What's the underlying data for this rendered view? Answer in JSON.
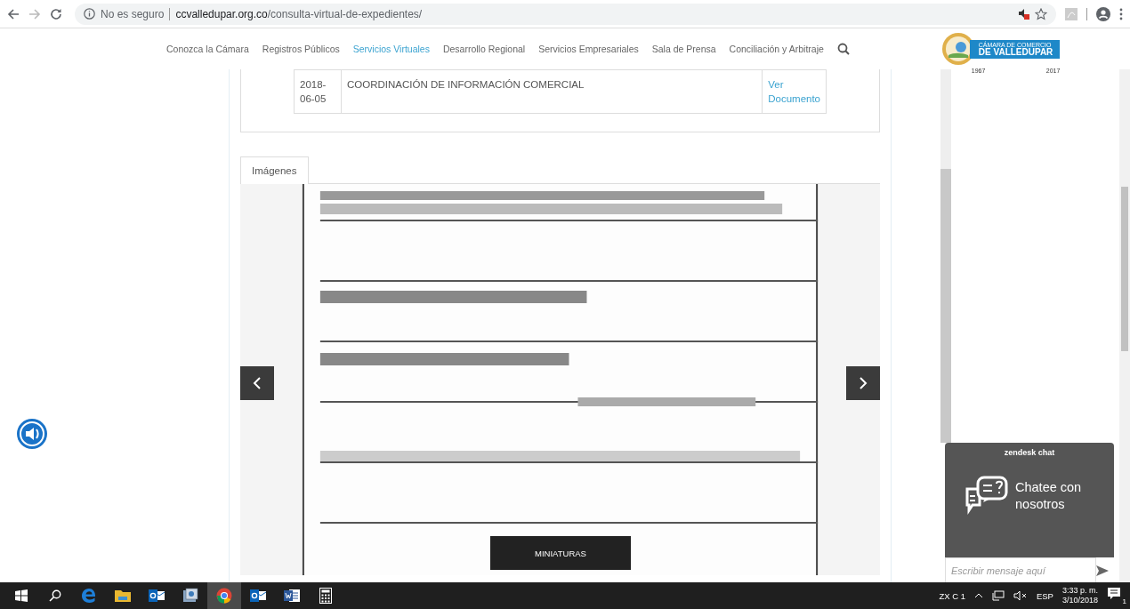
{
  "omnibox": {
    "security": "No es seguro",
    "domain": "ccvalledupar.org.co",
    "path": "/consulta-virtual-de-expedientes/"
  },
  "nav": {
    "items": [
      {
        "label": "Conozca la Cámara",
        "selected": false
      },
      {
        "label": "Registros Públicos",
        "selected": false
      },
      {
        "label": "Servicios Virtuales",
        "selected": true
      },
      {
        "label": "Desarrollo Regional",
        "selected": false
      },
      {
        "label": "Servicios Empresariales",
        "selected": false
      },
      {
        "label": "Sala de Prensa",
        "selected": false
      },
      {
        "label": "Conciliación y Arbitraje",
        "selected": false
      }
    ]
  },
  "logo": {
    "line_1": "CÁMARA DE COMERCIO",
    "line_2": "DE VALLEDUPAR",
    "year_from": "1967",
    "year_to": "2017"
  },
  "table": {
    "rows": [
      {
        "date": "2018-06-05",
        "description": "COORDINACIÓN DE INFORMACIÓN COMERCIAL",
        "link": "Ver Documento"
      }
    ]
  },
  "tabs": [
    {
      "label": "Imágenes",
      "selected": true
    }
  ],
  "carousel": {
    "thumbnails_button": "MINIATURAS"
  },
  "chat": {
    "brand": "zendesk chat",
    "title": "Chatee con nosotros",
    "placeholder": "Escribir mensaje aquí"
  },
  "taskbar": {
    "apps": [
      {
        "kind": "start",
        "selected": false
      },
      {
        "kind": "search",
        "selected": false
      },
      {
        "kind": "edge",
        "selected": false
      },
      {
        "kind": "folder",
        "selected": false
      },
      {
        "kind": "mail",
        "selected": false
      },
      {
        "kind": "viewer",
        "selected": false
      },
      {
        "kind": "chrome",
        "selected": true
      },
      {
        "kind": "mail",
        "selected": false
      },
      {
        "kind": "word",
        "selected": false
      },
      {
        "kind": "calculator",
        "selected": false
      }
    ],
    "tray": {
      "keyboard": "ZX C 1",
      "language": "ESP",
      "time": "3:33 p. m.",
      "date": "3/10/2018",
      "notifications": "1"
    }
  }
}
